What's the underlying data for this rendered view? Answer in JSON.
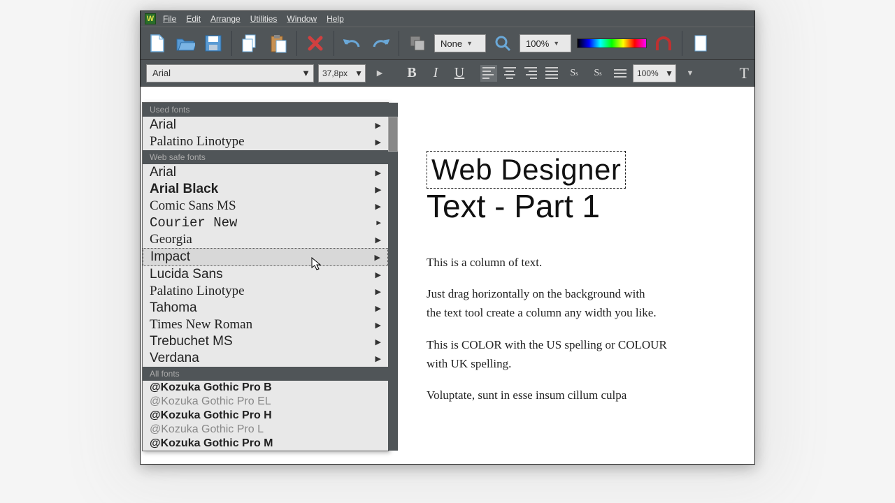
{
  "menubar": {
    "app_initial": "W",
    "items": [
      "File",
      "Edit",
      "Arrange",
      "Utilities",
      "Window",
      "Help"
    ]
  },
  "toolbar": {
    "layer_select": "None",
    "zoom": "100%"
  },
  "text_toolbar": {
    "font": "Arial",
    "size": "37,8px",
    "bold_label": "B",
    "italic_label": "I",
    "underline_label": "U",
    "line_height": "100%"
  },
  "dropdown": {
    "sections": {
      "used": "Used fonts",
      "websafe": "Web safe fonts",
      "all": "All fonts"
    },
    "used_fonts": [
      "Arial",
      "Palatino Linotype"
    ],
    "websafe_fonts": [
      "Arial",
      "Arial Black",
      "Comic Sans MS",
      "Courier New",
      "Georgia",
      "Impact",
      "Lucida Sans",
      "Palatino Linotype",
      "Tahoma",
      "Times New Roman",
      "Trebuchet MS",
      "Verdana"
    ],
    "all_fonts": [
      "@Kozuka Gothic Pro B",
      "@Kozuka Gothic Pro EL",
      "@Kozuka Gothic Pro H",
      "@Kozuka Gothic Pro L",
      "@Kozuka Gothic Pro M"
    ],
    "selected": "Impact"
  },
  "canvas": {
    "title": "Web Designer",
    "subtitle": "Text - Part 1",
    "p1": "This is a column of text.",
    "p2a": "Just drag horizontally on the background with",
    "p2b": "the text tool create a column any width you like.",
    "p3": "This is COLOR with the US spelling or COLOUR with UK spelling.",
    "p4": "Voluptate, sunt in esse insum cillum culpa"
  }
}
